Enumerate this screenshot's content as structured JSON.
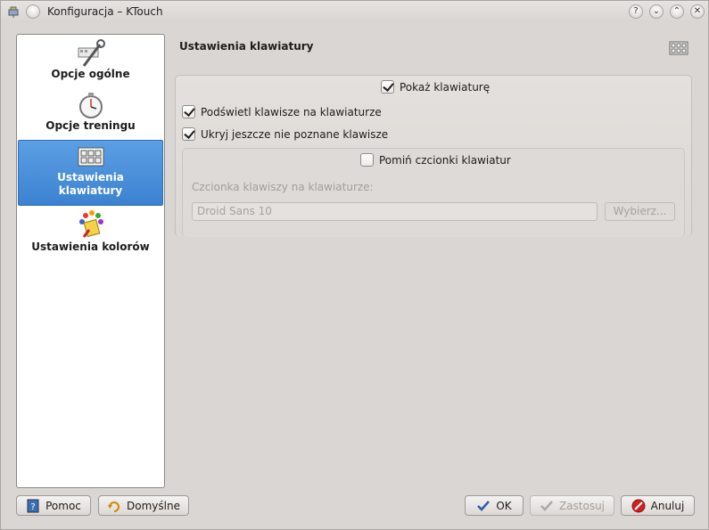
{
  "window": {
    "title": "Konfiguracja – KTouch"
  },
  "titlebar": {
    "help_glyph": "?",
    "minimize_glyph": "⌄",
    "maximize_glyph": "⌃",
    "close_glyph": "✕"
  },
  "sidebar": {
    "items": [
      {
        "label": "Opcje ogólne",
        "icon": "tools-icon",
        "selected": false
      },
      {
        "label": "Opcje treningu",
        "icon": "stopwatch-icon",
        "selected": false
      },
      {
        "label": "Ustawienia klawiatury",
        "label_line1": "Ustawienia",
        "label_line2": "klawiatury",
        "icon": "keyboard-icon",
        "selected": true
      },
      {
        "label": "Ustawienia kolorów",
        "icon": "color-palette-icon",
        "selected": false
      }
    ]
  },
  "page": {
    "title": "Ustawienia klawiatury",
    "header_icon": "keyboard-icon"
  },
  "options": {
    "show_keyboard": {
      "label": "Pokaż klawiaturę",
      "checked": true
    },
    "highlight_keys": {
      "label": "Podświetl klawisze na klawiaturze",
      "checked": true
    },
    "hide_unknown_keys": {
      "label": "Ukryj jeszcze nie poznane klawisze",
      "checked": true
    },
    "override_fonts": {
      "label": "Pomiń czcionki klawiatur",
      "checked": false
    },
    "font_label": "Czcionka klawiszy na klawiaturze:",
    "font_value": "Droid Sans 10",
    "choose_button": "Wybierz..."
  },
  "buttons": {
    "help": "Pomoc",
    "defaults": "Domyślne",
    "ok": "OK",
    "apply": "Zastosuj",
    "cancel": "Anuluj"
  },
  "colors": {
    "selection": "#3c82d0",
    "window_bg": "#dad6d3"
  }
}
